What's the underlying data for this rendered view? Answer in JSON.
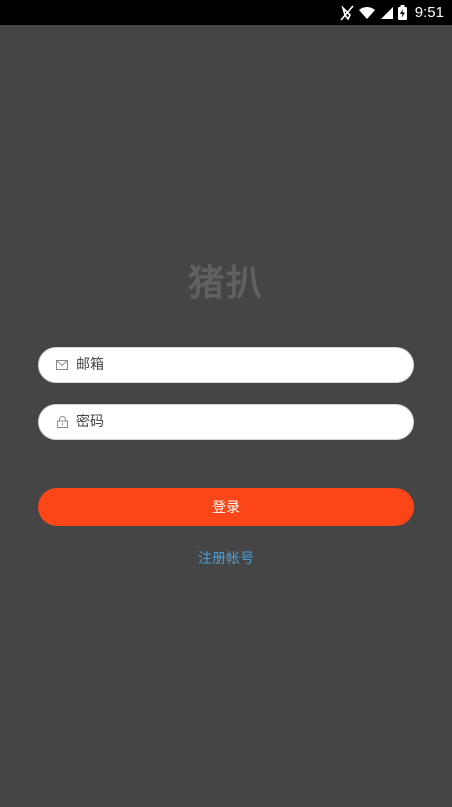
{
  "status_bar": {
    "time": "9:51",
    "icons": [
      "mute-icon",
      "wifi-icon",
      "signal-icon",
      "battery-icon"
    ]
  },
  "app": {
    "title": "猪扒"
  },
  "form": {
    "email": {
      "placeholder": "邮箱",
      "value": "",
      "icon": "envelope-icon"
    },
    "password": {
      "placeholder": "密码",
      "value": "",
      "icon": "lock-icon"
    },
    "login_label": "登录",
    "register_label": "注册帐号"
  },
  "colors": {
    "background": "#454545",
    "accent": "#fc4617",
    "link": "#4a9fd8",
    "title": "#606060"
  }
}
